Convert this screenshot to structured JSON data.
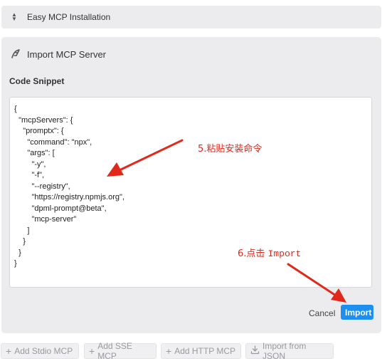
{
  "top_bar": {
    "title": "Easy MCP Installation",
    "icon": "chevron-up-down-icon"
  },
  "panel": {
    "title": "Import MCP Server",
    "icon": "feather-icon",
    "code_label": "Code Snippet",
    "code": "{\n  \"mcpServers\": {\n    \"promptx\": {\n      \"command\": \"npx\",\n      \"args\": [\n        \"-y\",\n        \"-f\",\n        \"--registry\",\n        \"https://registry.npmjs.org\",\n        \"dpml-prompt@beta\",\n        \"mcp-server\"\n      ]\n    }\n  }\n}",
    "cancel_label": "Cancel",
    "import_label": "Import"
  },
  "annotations": {
    "step5": "5.粘贴安装命令",
    "step6_prefix": "6.点击 ",
    "step6_word": "Import",
    "color": "#e0281b"
  },
  "bottom_buttons": [
    {
      "label": "Add Stdio MCP",
      "icon": "plus-icon"
    },
    {
      "label": "Add SSE MCP",
      "icon": "plus-icon"
    },
    {
      "label": "Add HTTP MCP",
      "icon": "plus-icon"
    },
    {
      "label": "Import from JSON",
      "icon": "download-icon"
    }
  ],
  "colors": {
    "accent": "#1c8ff0",
    "panel_bg": "#ececee"
  }
}
